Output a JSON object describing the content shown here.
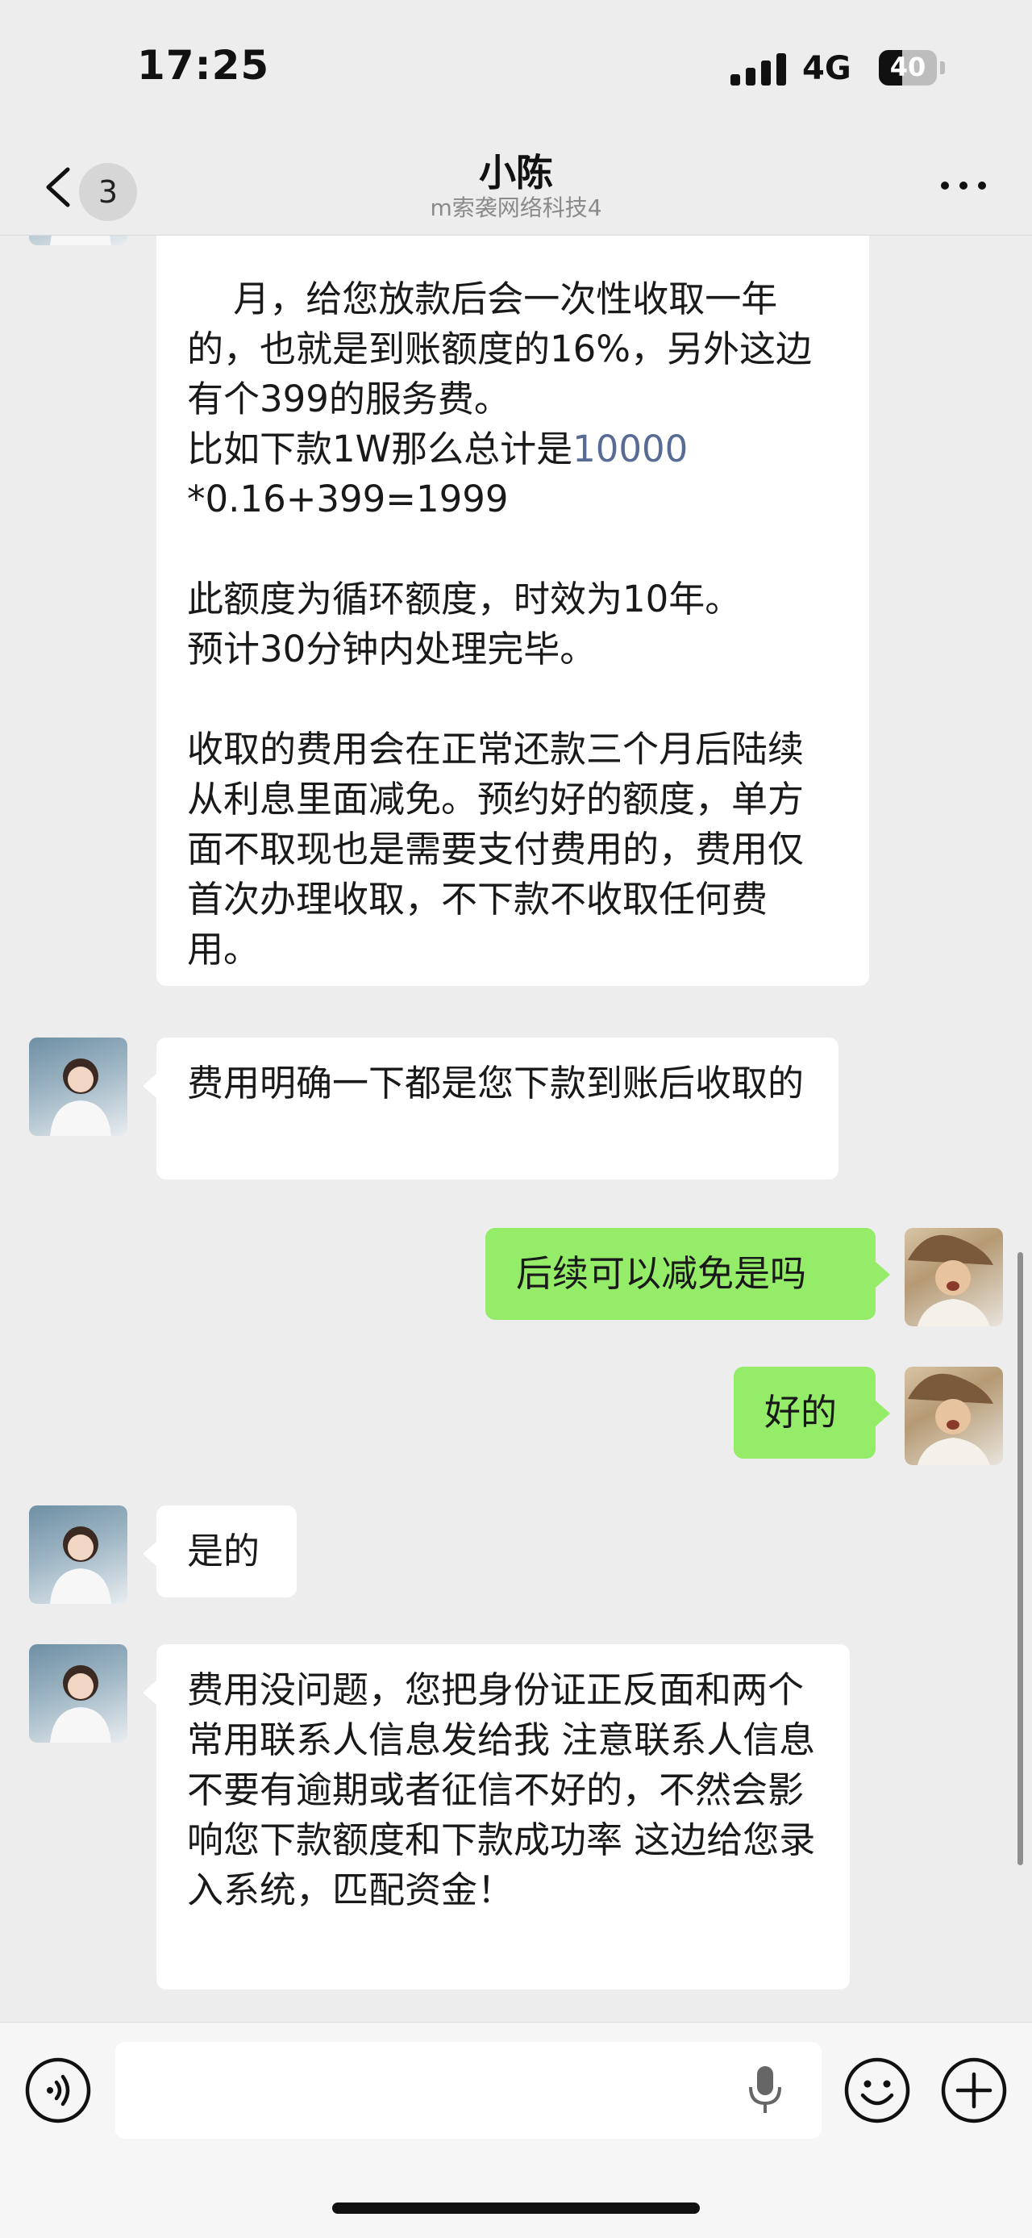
{
  "status_bar": {
    "time": "17:25",
    "network": "4G",
    "battery": "40",
    "battery_level": 0.4
  },
  "header": {
    "unread_count": "3",
    "title": "小陈",
    "subtitle": "m索袭网络科技4"
  },
  "messages": [
    {
      "sender": "contact",
      "parts": [
        "月，给您放款后会一次性收取一年的，也就是到账额度的16%，另外这边有个399的服务费。\n比如下款1W那么总计是",
        "10000",
        "\n*0.16+399=1999\n\n此额度为循环额度，时效为10年。\n预计30分钟内处理完毕。\n\n收取的费用会在正常还款三个月后陆续从利息里面减免。预约好的额度，单方面不取现也是需要支付费用的，费用仅首次办理收取，不下款不收取任何费用。"
      ]
    },
    {
      "sender": "contact",
      "text": "费用明确一下都是您下款到账后收取的"
    },
    {
      "sender": "me",
      "text": "后续可以减免是吗"
    },
    {
      "sender": "me",
      "text": "好的"
    },
    {
      "sender": "contact",
      "text": "是的"
    },
    {
      "sender": "contact",
      "text": "费用没问题，您把身份证正反面和两个常用联系人信息发给我 注意联系人信息不要有逾期或者征信不好的，不然会影响您下款额度和下款成功率 这边给您录入系统，匹配资金！"
    }
  ],
  "input_bar": {
    "placeholder": ""
  },
  "colors": {
    "background": "#ededed",
    "my_bubble": "#95ec69",
    "link": "#576b95"
  }
}
